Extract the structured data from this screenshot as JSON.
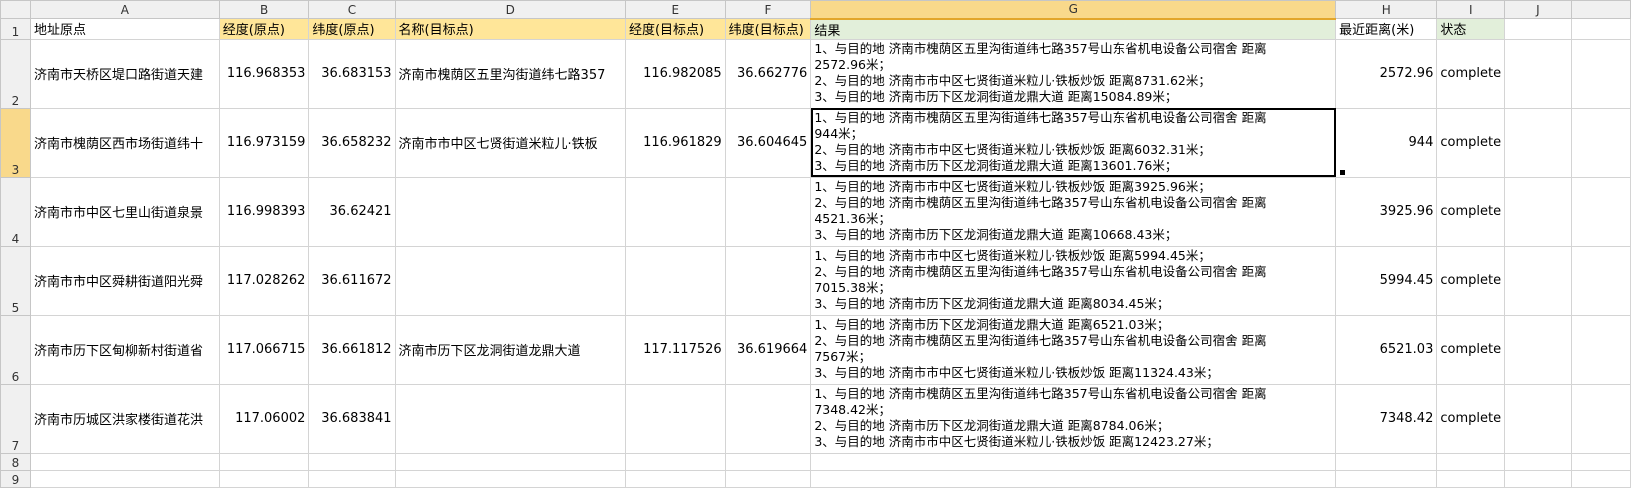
{
  "columns": [
    "A",
    "B",
    "C",
    "D",
    "E",
    "F",
    "G",
    "H",
    "I",
    "J"
  ],
  "row_numbers": [
    "1",
    "2",
    "3",
    "4",
    "5",
    "6",
    "7",
    "8",
    "9"
  ],
  "header": {
    "a": "地址原点",
    "b": "经度(原点)",
    "c": "纬度(原点)",
    "d": "名称(目标点)",
    "e": "经度(目标点)",
    "f": "纬度(目标点)",
    "g": "结果",
    "h": "最近距离(米)",
    "i": "状态"
  },
  "rows": [
    {
      "a": "济南市天桥区堤口路街道天建",
      "b": "116.968353",
      "c": "36.683153",
      "d": "济南市槐荫区五里沟街道纬七路357",
      "e": "116.982085",
      "f": "36.662776",
      "g": [
        "1、与目的地  济南市槐荫区五里沟街道纬七路357号山东省机电设备公司宿舍  距离",
        "2572.96米；",
        "2、与目的地  济南市市中区七贤街道米粒儿·铁板炒饭  距离8731.62米；",
        "3、与目的地  济南市历下区龙洞街道龙鼎大道  距离15084.89米；"
      ],
      "h": "2572.96",
      "i": "complete"
    },
    {
      "a": "济南市槐荫区西市场街道纬十",
      "b": "116.973159",
      "c": "36.658232",
      "d": "济南市市中区七贤街道米粒儿·铁板",
      "e": "116.961829",
      "f": "36.604645",
      "g": [
        "1、与目的地  济南市槐荫区五里沟街道纬七路357号山东省机电设备公司宿舍  距离",
        "944米；",
        "2、与目的地  济南市市中区七贤街道米粒儿·铁板炒饭  距离6032.31米；",
        "3、与目的地  济南市历下区龙洞街道龙鼎大道  距离13601.76米；"
      ],
      "h": "944",
      "i": "complete"
    },
    {
      "a": "济南市市中区七里山街道泉景",
      "b": "116.998393",
      "c": "36.62421",
      "d": "",
      "e": "",
      "f": "",
      "g": [
        "1、与目的地  济南市市中区七贤街道米粒儿·铁板炒饭  距离3925.96米；",
        "2、与目的地  济南市槐荫区五里沟街道纬七路357号山东省机电设备公司宿舍  距离",
        "4521.36米；",
        "3、与目的地  济南市历下区龙洞街道龙鼎大道  距离10668.43米；"
      ],
      "h": "3925.96",
      "i": "complete"
    },
    {
      "a": "济南市市中区舜耕街道阳光舜",
      "b": "117.028262",
      "c": "36.611672",
      "d": "",
      "e": "",
      "f": "",
      "g": [
        "1、与目的地  济南市市中区七贤街道米粒儿·铁板炒饭  距离5994.45米；",
        "2、与目的地  济南市槐荫区五里沟街道纬七路357号山东省机电设备公司宿舍  距离",
        "7015.38米；",
        "3、与目的地  济南市历下区龙洞街道龙鼎大道  距离8034.45米；"
      ],
      "h": "5994.45",
      "i": "complete"
    },
    {
      "a": "济南市历下区甸柳新村街道省",
      "b": "117.066715",
      "c": "36.661812",
      "d": "济南市历下区龙洞街道龙鼎大道",
      "e": "117.117526",
      "f": "36.619664",
      "g": [
        "1、与目的地  济南市历下区龙洞街道龙鼎大道  距离6521.03米；",
        "2、与目的地  济南市槐荫区五里沟街道纬七路357号山东省机电设备公司宿舍  距离",
        "7567米；",
        "3、与目的地  济南市市中区七贤街道米粒儿·铁板炒饭  距离11324.43米；"
      ],
      "h": "6521.03",
      "i": "complete"
    },
    {
      "a": "济南市历城区洪家楼街道花洪",
      "b": "117.06002",
      "c": "36.683841",
      "d": "",
      "e": "",
      "f": "",
      "g": [
        "1、与目的地  济南市槐荫区五里沟街道纬七路357号山东省机电设备公司宿舍  距离",
        "7348.42米；",
        "2、与目的地  济南市历下区龙洞街道龙鼎大道  距离8784.06米；",
        "3、与目的地  济南市市中区七贤街道米粒儿·铁板炒饭  距离12423.27米；"
      ],
      "h": "7348.42",
      "i": "complete"
    }
  ],
  "colors": {
    "header_yellow": "#ffe699",
    "header_green": "#e2efda",
    "selected_header": "#f9d98b",
    "gridline": "#d4d4d4"
  }
}
